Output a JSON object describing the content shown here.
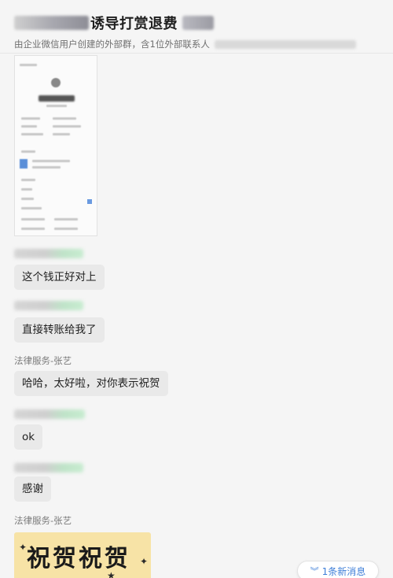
{
  "header": {
    "title": "诱导打赏退费",
    "subtitle": "由企业微信用户创建的外部群，含1位外部联系人"
  },
  "messages": [
    {
      "type": "bubble",
      "text": "这个钱正好对上"
    },
    {
      "type": "bubble",
      "text": "直接转账给我了"
    },
    {
      "type": "sender",
      "text": "法律服务-张艺"
    },
    {
      "type": "bubble",
      "text": "哈哈，太好啦，对你表示祝贺"
    },
    {
      "type": "bubble",
      "text": "ok"
    },
    {
      "type": "bubble",
      "text": "感谢"
    },
    {
      "type": "sender",
      "text": "法律服务-张艺"
    }
  ],
  "sticker": {
    "text": "祝贺祝贺"
  },
  "new_messages": {
    "label": "1条新消息",
    "icon": "double-chevron-down-icon"
  },
  "colors": {
    "bubble": "#e9e9e9",
    "accent": "#3f7fd8",
    "sticker_bg": "#f7e3a6"
  }
}
